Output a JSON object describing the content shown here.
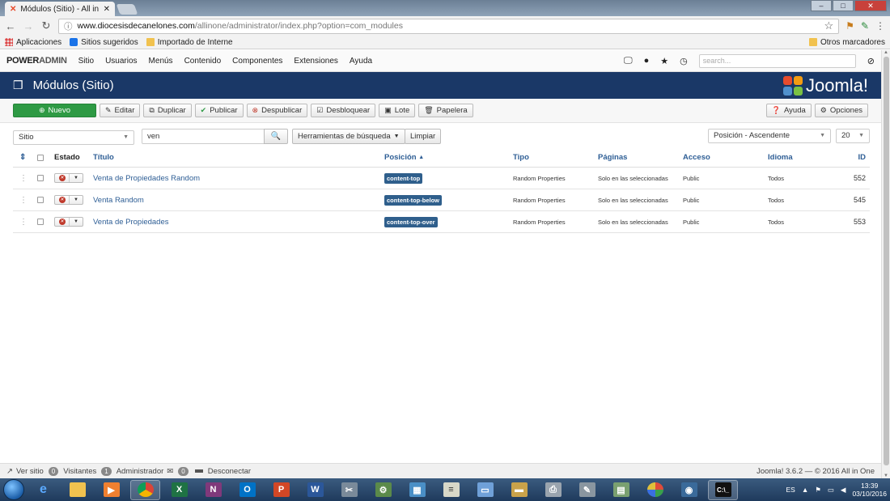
{
  "browser": {
    "tab_title": "Módulos (Sitio) - All in O",
    "url_host": "www.diocesisdecanelones.com",
    "url_path": "/allinone/administrator/index.php?option=com_modules",
    "bookmarks": [
      "Aplicaciones",
      "Sitios sugeridos",
      "Importado de Interne"
    ],
    "other_bookmarks": "Otros marcadores"
  },
  "admin": {
    "brand_a": "POWER",
    "brand_b": "ADMIN",
    "menu": [
      "Sitio",
      "Usuarios",
      "Menús",
      "Contenido",
      "Componentes",
      "Extensiones",
      "Ayuda"
    ],
    "search_placeholder": "search..."
  },
  "page": {
    "title": "Módulos (Sitio)",
    "logo_text": "Joomla!",
    "logo_colors": [
      "#e74c2d",
      "#f39c12",
      "#5091cd",
      "#7ac143"
    ]
  },
  "toolbar": {
    "new": "Nuevo",
    "edit": "Editar",
    "duplicate": "Duplicar",
    "publish": "Publicar",
    "unpublish": "Despublicar",
    "checkin": "Desbloquear",
    "batch": "Lote",
    "trash": "Papelera",
    "help": "Ayuda",
    "options": "Opciones"
  },
  "filters": {
    "client": "Sitio",
    "search_value": "ven",
    "tools": "Herramientas de búsqueda",
    "clear": "Limpiar",
    "ordering": "Posición - Ascendente",
    "limit": "20"
  },
  "table": {
    "headers": {
      "status": "Estado",
      "title": "Título",
      "position": "Posición",
      "type": "Tipo",
      "pages": "Páginas",
      "access": "Acceso",
      "language": "Idioma",
      "id": "ID"
    },
    "rows": [
      {
        "title": "Venta de Propiedades Random",
        "position": "content-top",
        "type": "Random Properties",
        "pages": "Solo en las seleccionadas",
        "access": "Public",
        "language": "Todos",
        "id": "552"
      },
      {
        "title": "Venta Random",
        "position": "content-top-below",
        "type": "Random Properties",
        "pages": "Solo en las seleccionadas",
        "access": "Public",
        "language": "Todos",
        "id": "545"
      },
      {
        "title": "Venta de Propiedades",
        "position": "content-top-over",
        "type": "Random Properties",
        "pages": "Solo en las seleccionadas",
        "access": "Public",
        "language": "Todos",
        "id": "553"
      }
    ]
  },
  "footer": {
    "view_site": "Ver sitio",
    "visitors_count": "0",
    "visitors": "Visitantes",
    "admins_count": "1",
    "admins": "Administrador",
    "messages_count": "0",
    "logout": "Desconectar",
    "version": "Joomla! 3.6.2 — © 2016 All in One"
  },
  "taskbar": {
    "language": "ES",
    "time": "13:39",
    "date": "03/10/2016"
  }
}
